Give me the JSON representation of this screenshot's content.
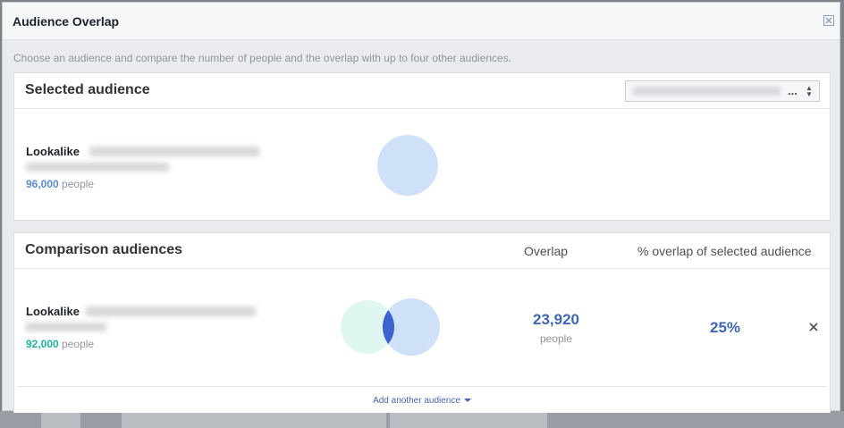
{
  "dialog": {
    "title": "Audience Overlap",
    "description": "Choose an audience and compare the number of people and the overlap with up to four other audiences."
  },
  "selected": {
    "heading": "Selected audience",
    "select_ellipsis": "...",
    "audience": {
      "name": "Lookalike",
      "count": "96,000",
      "count_unit": "people"
    },
    "colors": {
      "circle": "#cfe1f8",
      "count": "#5b8bd0"
    }
  },
  "comparison": {
    "heading": "Comparison audiences",
    "col_overlap": "Overlap",
    "col_percent": "% overlap of selected audience",
    "rows": [
      {
        "name": "Lookalike",
        "count": "92,000",
        "count_unit": "people",
        "overlap": "23,920",
        "overlap_unit": "people",
        "percent": "25%"
      }
    ],
    "add_label": "Add another audience",
    "colors": {
      "comparison_circle": "#e0f7f1",
      "selected_circle": "#cfe1f8",
      "intersection": "#3d63cf",
      "count": "#1fb3a1"
    }
  }
}
